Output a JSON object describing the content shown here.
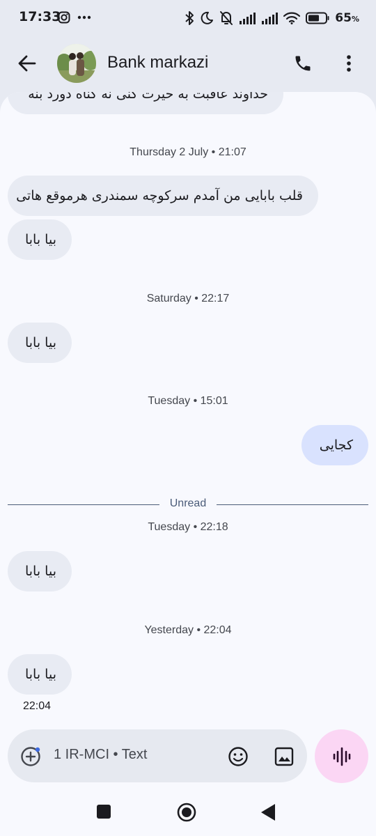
{
  "status_bar": {
    "time": "17:33",
    "battery_percent": "65",
    "battery_unit": "%",
    "battery_level": 0.65,
    "icons_left": [
      "instagram-icon",
      "more-notifications-icon"
    ],
    "icons_right": [
      "bluetooth-icon",
      "do-not-disturb-icon",
      "notifications-muted-icon",
      "signal-1-icon",
      "signal-2-icon",
      "wifi-icon",
      "battery-icon"
    ]
  },
  "app_bar": {
    "contact_name": "Bank markazi",
    "icons": [
      "back-arrow-icon",
      "phone-icon",
      "more-vert-icon"
    ]
  },
  "messages": [
    {
      "type": "incoming",
      "text": "خداوند عاقبت به خیرت کنی نه گناه دورد بنه"
    },
    {
      "type": "timestamp",
      "text": "Thursday 2 July • 21:07"
    },
    {
      "type": "incoming",
      "text": "قلب بابایی من آمدم سرکوچه سمندری هرموقع هاتی"
    },
    {
      "type": "incoming",
      "text": "بیا بابا"
    },
    {
      "type": "timestamp",
      "text": "Saturday • 22:17"
    },
    {
      "type": "incoming",
      "text": "بیا بابا"
    },
    {
      "type": "timestamp",
      "text": "Tuesday • 15:01"
    },
    {
      "type": "outgoing",
      "text": "کجایی"
    },
    {
      "type": "divider",
      "text": "Unread"
    },
    {
      "type": "timestamp",
      "text": "Tuesday • 22:18"
    },
    {
      "type": "incoming",
      "text": "بیا بابا"
    },
    {
      "type": "timestamp",
      "text": "Yesterday • 22:04"
    },
    {
      "type": "incoming",
      "text": "بیا بابا"
    },
    {
      "type": "sent_time",
      "text": "22:04"
    }
  ],
  "compose": {
    "placeholder": "1 IR-MCI • Text",
    "icons": [
      "add-attachment-icon",
      "emoji-icon",
      "gallery-icon",
      "voice-message-icon"
    ],
    "voice_button_color": "#fbd6f4"
  },
  "nav_bar": {
    "icons": [
      "recents-icon",
      "home-icon",
      "back-icon"
    ]
  },
  "colors": {
    "background": "#e7eaf2",
    "conversation_bg": "#f8f9fe",
    "incoming_bubble": "#e8ebf3",
    "outgoing_bubble": "#d9e2fe",
    "unread_divider": "#4a5b78"
  }
}
